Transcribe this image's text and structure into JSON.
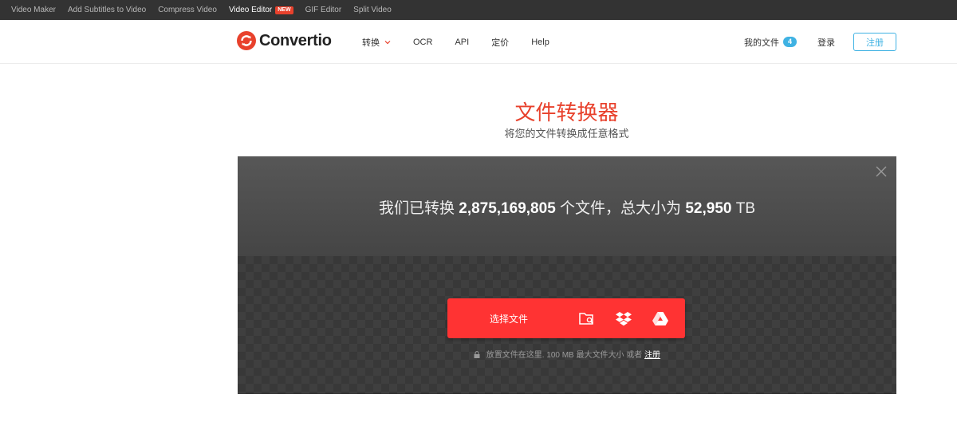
{
  "topbar": {
    "links": [
      {
        "label": "Video Maker"
      },
      {
        "label": "Add Subtitles to Video"
      },
      {
        "label": "Compress Video"
      },
      {
        "label": "Video Editor",
        "badge": "NEW"
      },
      {
        "label": "GIF Editor"
      },
      {
        "label": "Split Video"
      }
    ]
  },
  "header": {
    "logo_text": "Convertio",
    "nav": [
      {
        "label": "转换"
      },
      {
        "label": "OCR"
      },
      {
        "label": "API"
      },
      {
        "label": "定价"
      },
      {
        "label": "Help"
      }
    ],
    "my_files_label": "我的文件",
    "my_files_count": "4",
    "login_label": "登录",
    "signup_label": "注册"
  },
  "hero": {
    "title": "文件转换器",
    "subtitle": "将您的文件转换成任意格式"
  },
  "panel": {
    "stats_prefix": "我们已转换",
    "stats_files": "2,875,169,805",
    "stats_middle": "个文件，总大小为",
    "stats_size": "52,950",
    "stats_unit": "TB",
    "choose_label": "选择文件",
    "icons": [
      "folder-search-icon",
      "dropbox-icon",
      "google-drive-icon"
    ],
    "hint_text": "放置文件在这里. 100 MB 最大文件大小 或者",
    "hint_link": "注册"
  },
  "colors": {
    "accent": "#ff3333",
    "title_red": "#e8412c",
    "signup_blue": "#3fb2e3",
    "topbar_bg": "#333333"
  }
}
